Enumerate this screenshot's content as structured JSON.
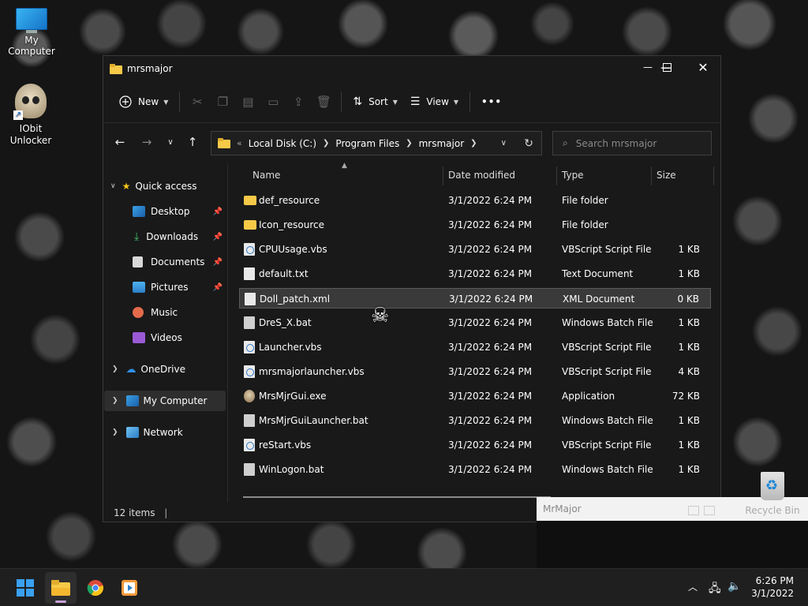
{
  "desktop": {
    "icons": [
      {
        "label": "My Computer"
      },
      {
        "label": "IObit Unlocker"
      },
      {
        "label": "Recycle Bin"
      }
    ]
  },
  "explorer": {
    "title": "mrsmajor",
    "toolbar": {
      "new_label": "New",
      "sort_label": "Sort",
      "view_label": "View",
      "more_label": "•••"
    },
    "breadcrumb": {
      "overflow": "«",
      "parts": [
        "Local Disk (C:)",
        "Program Files",
        "mrsmajor"
      ]
    },
    "search_placeholder": "Search mrsmajor",
    "nav": {
      "quick_access": "Quick access",
      "quick_items": [
        "Desktop",
        "Downloads",
        "Documents",
        "Pictures",
        "Music",
        "Videos"
      ],
      "onedrive": "OneDrive",
      "my_computer": "My Computer",
      "network": "Network"
    },
    "columns": {
      "name": "Name",
      "date": "Date modified",
      "type": "Type",
      "size": "Size"
    },
    "files": [
      {
        "name": "def_resource",
        "date": "3/1/2022 6:24 PM",
        "type": "File folder",
        "size": "",
        "icon": "folder-icon"
      },
      {
        "name": "Icon_resource",
        "date": "3/1/2022 6:24 PM",
        "type": "File folder",
        "size": "",
        "icon": "folder-icon"
      },
      {
        "name": "CPUUsage.vbs",
        "date": "3/1/2022 6:24 PM",
        "type": "VBScript Script File",
        "size": "1 KB",
        "icon": "vbscript-icon"
      },
      {
        "name": "default.txt",
        "date": "3/1/2022 6:24 PM",
        "type": "Text Document",
        "size": "1 KB",
        "icon": "text-file-icon"
      },
      {
        "name": "Doll_patch.xml",
        "date": "3/1/2022 6:24 PM",
        "type": "XML Document",
        "size": "0 KB",
        "icon": "xml-file-icon"
      },
      {
        "name": "DreS_X.bat",
        "date": "3/1/2022 6:24 PM",
        "type": "Windows Batch File",
        "size": "1 KB",
        "icon": "batch-file-icon"
      },
      {
        "name": "Launcher.vbs",
        "date": "3/1/2022 6:24 PM",
        "type": "VBScript Script File",
        "size": "1 KB",
        "icon": "vbscript-icon"
      },
      {
        "name": "mrsmajorlauncher.vbs",
        "date": "3/1/2022 6:24 PM",
        "type": "VBScript Script File",
        "size": "4 KB",
        "icon": "vbscript-icon"
      },
      {
        "name": "MrsMjrGui.exe",
        "date": "3/1/2022 6:24 PM",
        "type": "Application",
        "size": "72 KB",
        "icon": "application-icon"
      },
      {
        "name": "MrsMjrGuiLauncher.bat",
        "date": "3/1/2022 6:24 PM",
        "type": "Windows Batch File",
        "size": "1 KB",
        "icon": "batch-file-icon"
      },
      {
        "name": "reStart.vbs",
        "date": "3/1/2022 6:24 PM",
        "type": "VBScript Script File",
        "size": "1 KB",
        "icon": "vbscript-icon"
      },
      {
        "name": "WinLogon.bat",
        "date": "3/1/2022 6:24 PM",
        "type": "Windows Batch File",
        "size": "1 KB",
        "icon": "batch-file-icon"
      }
    ],
    "status": "12 items"
  },
  "mrmajor_window": {
    "title": "MrMajor"
  },
  "taskbar": {
    "time": "6:26 PM",
    "date": "3/1/2022"
  },
  "colors": {
    "accent": "#0078d4",
    "folder": "#f7c948",
    "window_bg": "#191919"
  }
}
